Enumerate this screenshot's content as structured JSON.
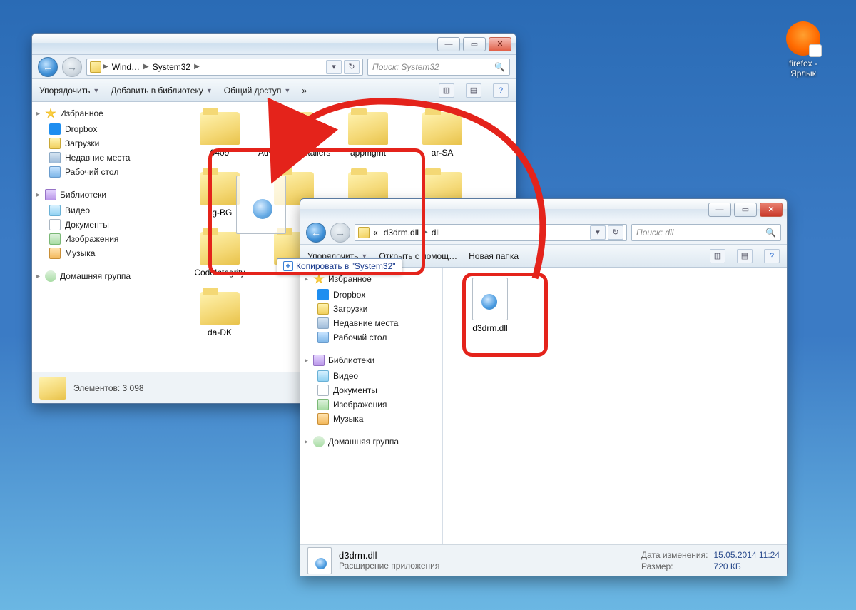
{
  "desktop": {
    "shortcut_label": "firefox - Ярлык"
  },
  "win1": {
    "breadcrumbs": [
      "Wind…",
      "System32"
    ],
    "search_placeholder": "Поиск: System32",
    "toolbar": {
      "organize": "Упорядочить",
      "addlib": "Добавить в библиотеку",
      "share": "Общий доступ"
    },
    "side": {
      "fav_header": "Избранное",
      "fav": [
        "Dropbox",
        "Загрузки",
        "Недавние места",
        "Рабочий стол"
      ],
      "lib_header": "Библиотеки",
      "lib": [
        "Видео",
        "Документы",
        "Изображения",
        "Музыка"
      ],
      "homegroup": "Домашняя группа"
    },
    "tiles": [
      "0409",
      "AdvancedInstallers",
      "appmgmt",
      "ar-SA",
      "bg-BG",
      "",
      "",
      "",
      "CodeIntegrity",
      "",
      "",
      "",
      "da-DK"
    ],
    "status_label": "Элементов: 3 098"
  },
  "win2": {
    "breadcrumbs_prefix": "«",
    "breadcrumbs": [
      "d3drm.dll",
      "dll"
    ],
    "search_placeholder": "Поиск: dll",
    "toolbar": {
      "organize": "Упорядочить",
      "openwith": "Открыть с помощ…",
      "newfolder": "Новая папка"
    },
    "side": {
      "fav_header": "Избранное",
      "fav": [
        "Dropbox",
        "Загрузки",
        "Недавние места",
        "Рабочий стол"
      ],
      "lib_header": "Библиотеки",
      "lib": [
        "Видео",
        "Документы",
        "Изображения",
        "Музыка"
      ],
      "homegroup": "Домашняя группа"
    },
    "file_label": "d3drm.dll",
    "details": {
      "name": "d3drm.dll",
      "type": "Расширение приложения",
      "date_label": "Дата изменения:",
      "date": "15.05.2014 11:24",
      "size_label": "Размер:",
      "size": "720 КБ"
    }
  },
  "drag": {
    "copy_text": "Копировать в \"System32\""
  }
}
